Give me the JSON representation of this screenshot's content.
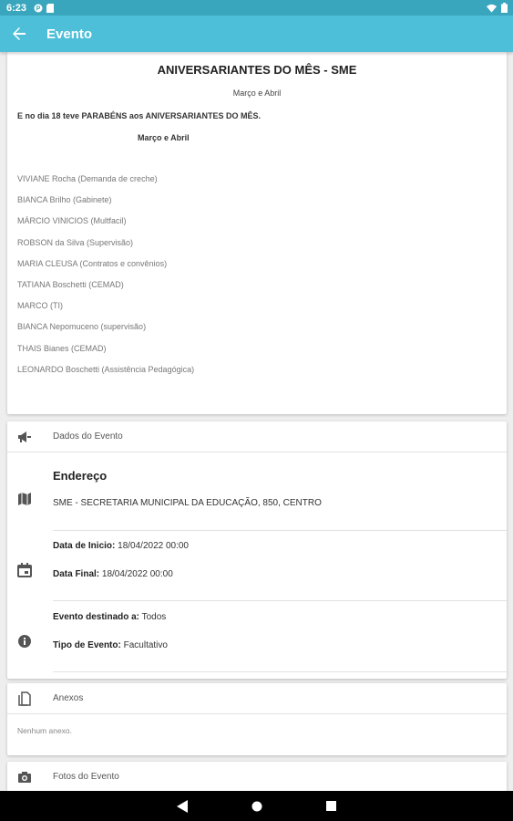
{
  "status_bar": {
    "time": "6:23"
  },
  "app_bar": {
    "title": "Evento"
  },
  "description": {
    "title": "ANIVERSARIANTES DO MÊS - SME",
    "subtitle": "Março e Abril",
    "line1": "E no dia 18 teve PARABÉNS  aos  ANIVERSARIANTES DO MÊS.",
    "line2": "Março e Abril",
    "names": [
      "VIVIANE Rocha  (Demanda de creche)",
      "BIANCA Brilho  (Gabinete)",
      "MÁRCIO VINICIOS (Multfacil)",
      "ROBSON da Silva  (Supervisão)",
      "MARIA CLEUSA (Contratos e convênios)",
      "TATIANA Boschetti  (CEMAD)",
      "MARCO (TI)",
      "BIANCA Nepomuceno (supervisão)",
      "THAIS Bianes (CEMAD)",
      "LEONARDO Boschetti  (Assistência Pedagógica)"
    ]
  },
  "event_data": {
    "section_label": "Dados do Evento",
    "address_title": "Endereço",
    "address": "SME - SECRETARIA MUNICIPAL DA EDUCAÇÃO, 850, CENTRO",
    "start_label": "Data de Inicio:",
    "start_value": "18/04/2022 00:00",
    "end_label": "Data Final:",
    "end_value": "18/04/2022 00:00",
    "target_label": "Evento destinado a:",
    "target_value": "Todos",
    "type_label": "Tipo de Evento:",
    "type_value": "Facultativo"
  },
  "attachments": {
    "section_label": "Anexos",
    "empty_text": "Nenhum anexo."
  },
  "photos": {
    "section_label": "Fotos do Evento"
  },
  "icons": {
    "back": "arrow-left-icon",
    "dados": "megaphone-icon",
    "map": "map-icon",
    "calendar": "calendar-icon",
    "info": "info-icon",
    "attachment": "attachment-icon",
    "camera": "camera-icon"
  },
  "colors": {
    "status_bar": "#3aa6bd",
    "app_bar": "#4dbfd8",
    "background": "#eeeeee",
    "nav_bar": "#000000"
  }
}
